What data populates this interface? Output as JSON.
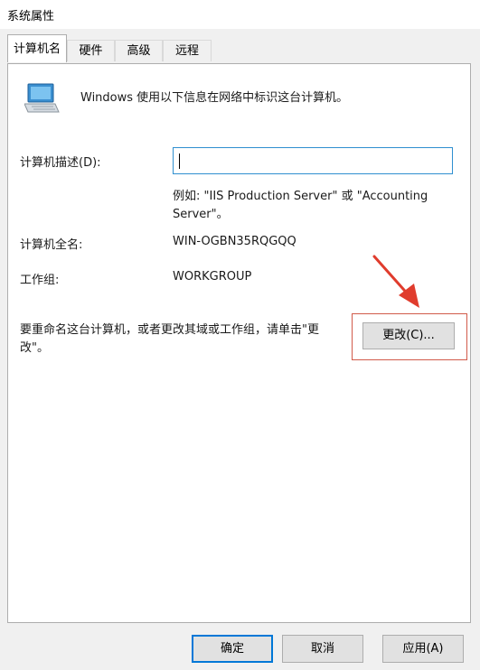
{
  "window": {
    "title": "系统属性"
  },
  "tabs": [
    {
      "label": "计算机名"
    },
    {
      "label": "硬件"
    },
    {
      "label": "高级"
    },
    {
      "label": "远程"
    }
  ],
  "panel": {
    "intro_text": "Windows 使用以下信息在网络中标识这台计算机。",
    "description_label": "计算机描述(D):",
    "description_value": "",
    "example_line1": "例如: \"IIS Production Server\" 或 \"Accounting",
    "example_line2": "Server\"。",
    "full_name_label": "计算机全名:",
    "full_name_value": "WIN-OGBN35RQGQQ",
    "workgroup_label": "工作组:",
    "workgroup_value": "WORKGROUP",
    "rename_line1": "要重命名这台计算机，或者更改其域或工作组，请单击\"更",
    "rename_line2": "改\"。",
    "change_button": "更改(C)..."
  },
  "footer": {
    "ok": "确定",
    "cancel": "取消",
    "apply": "应用(A)"
  },
  "colors": {
    "accent": "#0078d7",
    "annotation": "#e03c2d"
  }
}
